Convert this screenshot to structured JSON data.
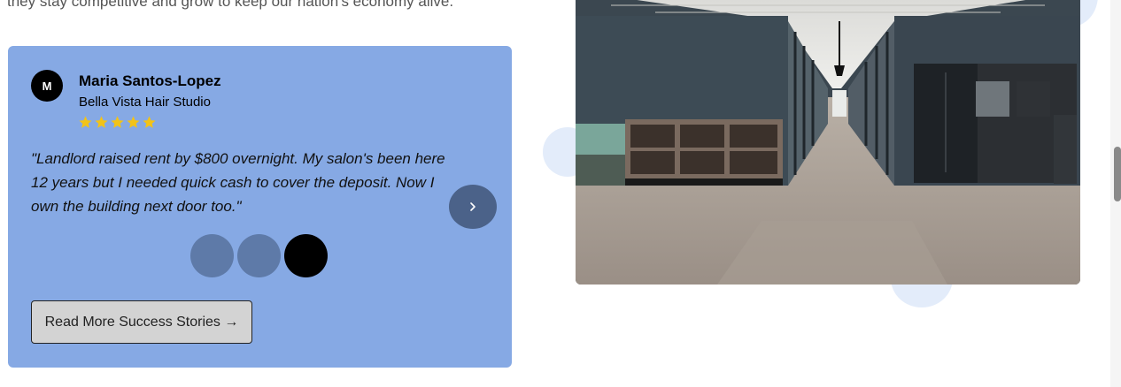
{
  "intro": {
    "text": "they stay competitive and grow to keep our nation's economy alive."
  },
  "testimonial": {
    "avatar_initial": "M",
    "author_name": "Maria Santos-Lopez",
    "business": "Bella Vista Hair Studio",
    "rating": 5,
    "star_color": "#f2c318",
    "quote": "\"Landlord raised rent by $800 overnight. My salon's been here 12 years but I needed quick cash to cover the deposit. Now I own the building next door too.\"",
    "next_icon": "chevron-right-icon",
    "pagination": {
      "total": 3,
      "active_index": 2
    },
    "read_more_label": "Read More Success Stories →"
  },
  "photo": {
    "subject": "office-corridor-photo"
  },
  "colors": {
    "card_bg": "#86a9e4",
    "next_button": "#4b6289",
    "dot_inactive": "#5e7aa8",
    "dot_active": "#000000"
  }
}
